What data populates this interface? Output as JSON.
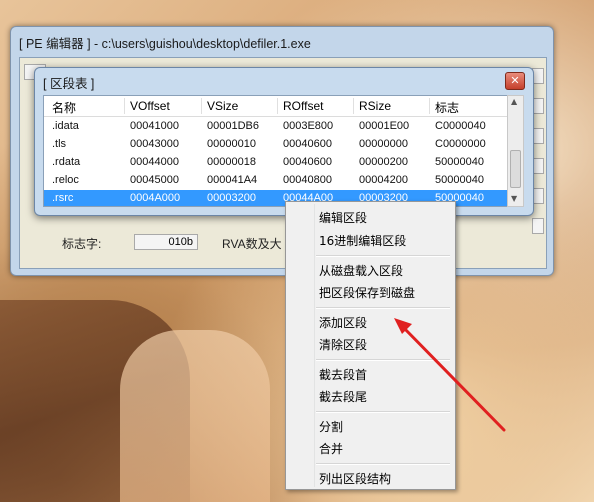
{
  "main_window": {
    "title": "[ PE 编辑器 ] - c:\\users\\guishou\\desktop\\defiler.1.exe",
    "bottom_left_label": "标志字:",
    "bottom_left_value": "010b",
    "bottom_mid_label": "RVA数及大"
  },
  "section_dialog": {
    "title": "[ 区段表 ]",
    "close_icon": "close-icon",
    "columns": [
      "名称",
      "VOffset",
      "VSize",
      "ROffset",
      "RSize",
      "标志"
    ],
    "rows": [
      {
        "name": ".idata",
        "voffset": "00041000",
        "vsize": "00001DB6",
        "roffset": "0003E800",
        "rsize": "00001E00",
        "flags": "C0000040"
      },
      {
        "name": ".tls",
        "voffset": "00043000",
        "vsize": "00000010",
        "roffset": "00040600",
        "rsize": "00000000",
        "flags": "C0000000"
      },
      {
        "name": ".rdata",
        "voffset": "00044000",
        "vsize": "00000018",
        "roffset": "00040600",
        "rsize": "00000200",
        "flags": "50000040"
      },
      {
        "name": ".reloc",
        "voffset": "00045000",
        "vsize": "000041A4",
        "roffset": "00040800",
        "rsize": "00004200",
        "flags": "50000040"
      },
      {
        "name": ".rsrc",
        "voffset": "0004A000",
        "vsize": "00003200",
        "roffset": "00044A00",
        "rsize": "00003200",
        "flags": "50000040"
      }
    ],
    "selected_row": 4
  },
  "context_menu": {
    "groups": [
      [
        "编辑区段",
        "16进制编辑区段"
      ],
      [
        "从磁盘载入区段",
        "把区段保存到磁盘"
      ],
      [
        "添加区段",
        "清除区段"
      ],
      [
        "截去段首",
        "截去段尾"
      ],
      [
        "分割",
        "合并"
      ],
      [
        "列出区段结构"
      ]
    ]
  },
  "annotation": {
    "arrow_color": "#e02020"
  },
  "colors": {
    "selection": "#3399ff",
    "window_frame": "#c3d6ea"
  }
}
